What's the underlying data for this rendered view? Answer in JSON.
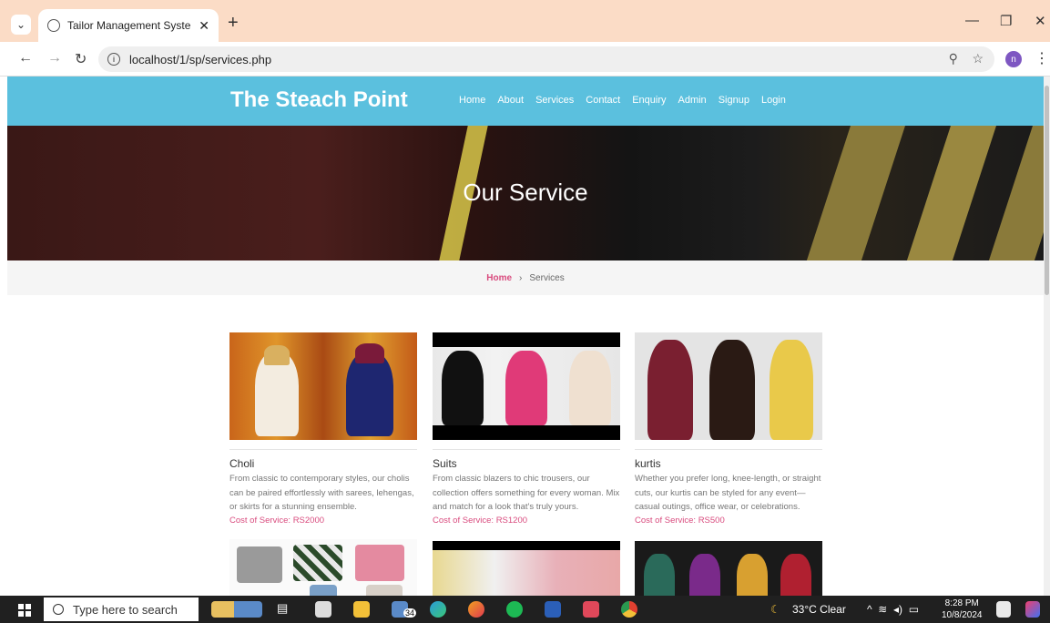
{
  "browser": {
    "tab_title": "Tailor Management System | se",
    "url": "localhost/1/sp/services.php",
    "profile_initial": "n"
  },
  "site": {
    "brand": "The Steach Point",
    "menu": [
      "Home",
      "About",
      "Services",
      "Contact",
      "Enquiry",
      "Admin",
      "Signup",
      "Login"
    ],
    "hero_title": "Our Service",
    "breadcrumb": {
      "home": "Home",
      "separator": "›",
      "current": "Services"
    }
  },
  "services": [
    {
      "name": "Choli",
      "description": "From classic to contemporary styles, our cholis can be paired effortlessly with sarees, lehengas, or skirts for a stunning ensemble.",
      "cost": "Cost of Service: RS2000"
    },
    {
      "name": "Suits",
      "description": "From classic blazers to chic trousers, our collection offers something for every woman. Mix and match for a look that's truly yours.",
      "cost": "Cost of Service: RS1200"
    },
    {
      "name": "kurtis",
      "description": "Whether you prefer long, knee-length, or straight cuts, our kurtis can be styled for any event—casual outings, office wear, or celebrations.",
      "cost": "Cost of Service: RS500"
    }
  ],
  "taskbar": {
    "search_placeholder": "Type here to search",
    "mail_badge": "34",
    "weather": "33°C  Clear",
    "time": "8:28 PM",
    "date": "10/8/2024"
  },
  "colors": {
    "header": "#5bc0de",
    "accent": "#d94b7e",
    "tab_strip": "#fbdcc6"
  }
}
